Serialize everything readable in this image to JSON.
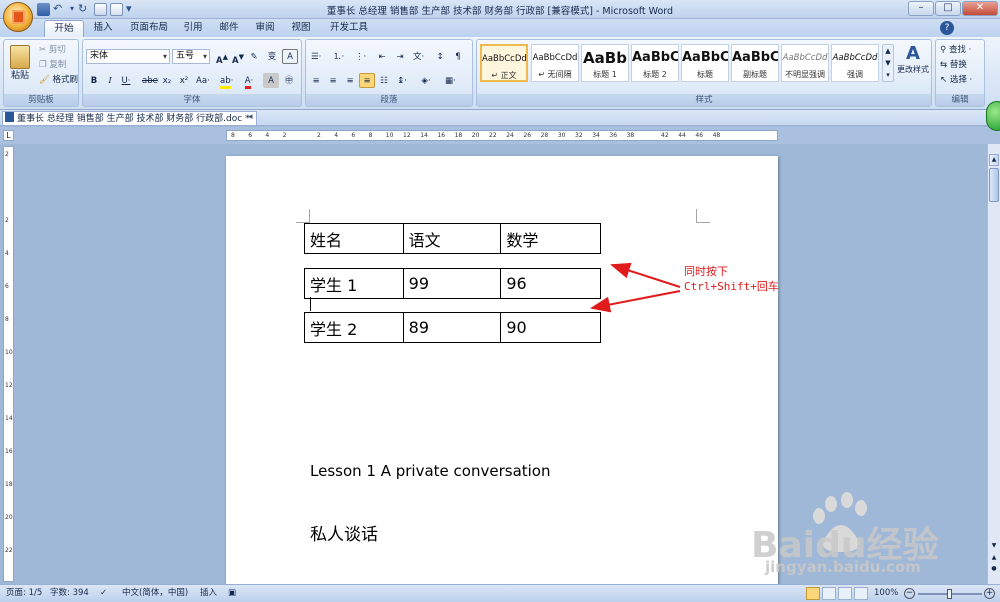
{
  "window": {
    "title": "董事长 总经理 销售部 生产部 技术部 财务部 行政部 [兼容模式] - Microsoft Word",
    "minimize": "–",
    "maximize": "□",
    "close": "✕"
  },
  "tabs": [
    "开始",
    "插入",
    "页面布局",
    "引用",
    "邮件",
    "审阅",
    "视图",
    "开发工具"
  ],
  "ribbon": {
    "clipboard": {
      "label": "剪贴板",
      "paste": "粘贴",
      "cut": "剪切",
      "copy": "复制",
      "format_painter": "格式刷"
    },
    "font": {
      "label": "字体",
      "font_name": "宋体",
      "font_size": "五号"
    },
    "paragraph": {
      "label": "段落"
    },
    "styles": {
      "label": "样式",
      "items": [
        {
          "sample": "AaBbCcDd",
          "name": "↵ 正文"
        },
        {
          "sample": "AaBbCcDd",
          "name": "↵ 无间隔"
        },
        {
          "sample": "AaBb",
          "name": "标题 1"
        },
        {
          "sample": "AaBbC",
          "name": "标题 2"
        },
        {
          "sample": "AaBbC",
          "name": "标题"
        },
        {
          "sample": "AaBbC",
          "name": "副标题"
        },
        {
          "sample": "AaBbCcDd",
          "name": "不明显强调"
        },
        {
          "sample": "AaBbCcDd",
          "name": "强调"
        }
      ],
      "change_styles": "更改样式"
    },
    "editing": {
      "label": "编辑",
      "find": "查找 ·",
      "replace": "替换",
      "select": "选择 ·"
    }
  },
  "document": {
    "tab_name": "董事长 总经理 销售部 生产部 技术部 财务部 行政部.doc *",
    "table1": [
      [
        "姓名",
        "语文",
        "数学"
      ]
    ],
    "table2": [
      [
        "学生 1",
        "99",
        "96"
      ]
    ],
    "table3": [
      [
        "学生 2",
        "89",
        "90"
      ]
    ],
    "lesson": "Lesson 1 A private conversation",
    "chinese": "私人谈话"
  },
  "annotation": {
    "line1": "同时按下",
    "line2": "Ctrl+Shift+回车"
  },
  "status": {
    "page": "页面: 1/5",
    "words": "字数: 394",
    "language": "中文(简体，中国)",
    "mode": "插入",
    "zoom": "100%"
  },
  "watermark": {
    "brand": "Baidu经验",
    "url": "jingyan.baidu.com"
  },
  "ruler_numbers": [
    "8",
    "6",
    "4",
    "2",
    "",
    "2",
    "4",
    "6",
    "8",
    "10",
    "12",
    "14",
    "16",
    "18",
    "20",
    "22",
    "24",
    "26",
    "28",
    "30",
    "32",
    "34",
    "36",
    "38",
    "",
    "42",
    "44",
    "46",
    "48"
  ],
  "vruler_numbers": [
    "2",
    "",
    "2",
    "4",
    "6",
    "8",
    "10",
    "12",
    "14",
    "16",
    "18",
    "20",
    "22"
  ],
  "colors": {
    "accent": "#2b579a",
    "annotation": "#e01b1b"
  }
}
